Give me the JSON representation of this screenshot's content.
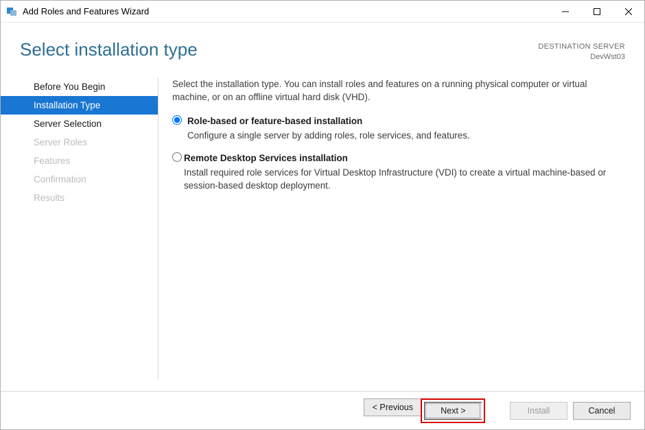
{
  "window": {
    "title": "Add Roles and Features Wizard"
  },
  "header": {
    "page_title": "Select installation type",
    "destination_label": "DESTINATION SERVER",
    "destination_server": "DevWst03"
  },
  "sidebar": {
    "steps": [
      {
        "label": "Before You Begin",
        "state": "normal"
      },
      {
        "label": "Installation Type",
        "state": "selected"
      },
      {
        "label": "Server Selection",
        "state": "normal"
      },
      {
        "label": "Server Roles",
        "state": "disabled"
      },
      {
        "label": "Features",
        "state": "disabled"
      },
      {
        "label": "Confirmation",
        "state": "disabled"
      },
      {
        "label": "Results",
        "state": "disabled"
      }
    ]
  },
  "content": {
    "intro": "Select the installation type. You can install roles and features on a running physical computer or virtual machine, or on an offline virtual hard disk (VHD).",
    "options": [
      {
        "title": "Role-based or feature-based installation",
        "desc": "Configure a single server by adding roles, role services, and features.",
        "selected": true
      },
      {
        "title": "Remote Desktop Services installation",
        "desc": "Install required role services for Virtual Desktop Infrastructure (VDI) to create a virtual machine-based or session-based desktop deployment.",
        "selected": false
      }
    ]
  },
  "footer": {
    "previous": "< Previous",
    "next": "Next >",
    "install": "Install",
    "cancel": "Cancel",
    "install_enabled": false
  }
}
